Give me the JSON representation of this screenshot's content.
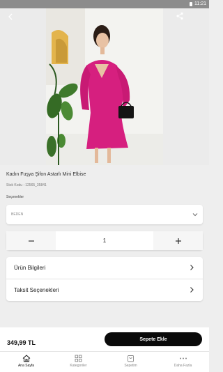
{
  "status_bar": {
    "time": "11:21"
  },
  "header": {
    "back_icon": "chevron-left-icon",
    "share_icon": "share-icon"
  },
  "product": {
    "title": "Kadın Fuşya Şifon Astarlı Mini Elbise",
    "sku": "Stok Kodu : 12565_35841",
    "options_label": "Seçenekler",
    "size_select": {
      "label": "BEDEN"
    },
    "quantity": "1",
    "price": "349,99 TL"
  },
  "sections": [
    {
      "label": "Ürün Bilgileri"
    },
    {
      "label": "Taksit Seçenekleri"
    }
  ],
  "cart": {
    "add_label": "Sepete Ekle"
  },
  "tabs": [
    {
      "label": "Ana Sayfa",
      "icon": "home-icon"
    },
    {
      "label": "Kategoriler",
      "icon": "grid-icon"
    },
    {
      "label": "Sepetim",
      "icon": "bag-icon"
    },
    {
      "label": "Daha Fazla",
      "icon": "more-icon"
    }
  ],
  "colors": {
    "dress": "#d61f7f",
    "button": "#0a0a0a",
    "background": "#eeeeee"
  }
}
